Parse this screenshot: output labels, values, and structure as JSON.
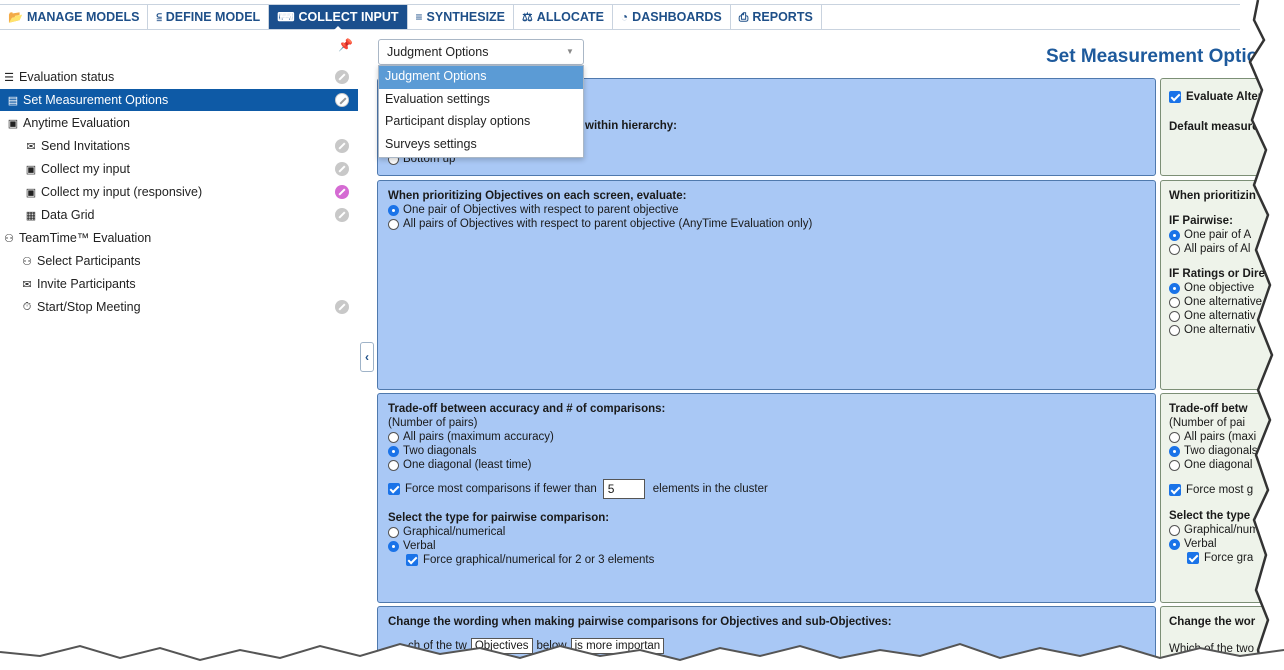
{
  "topnav": {
    "tabs": [
      {
        "label": "MANAGE MODELS",
        "icon": "folder-icon",
        "glyph": "📂"
      },
      {
        "label": "DEFINE MODEL",
        "icon": "hierarchy-icon",
        "glyph": "⫅"
      },
      {
        "label": "COLLECT INPUT",
        "icon": "keyboard-icon",
        "glyph": "⌨"
      },
      {
        "label": "SYNTHESIZE",
        "icon": "bar-chart-icon",
        "glyph": "≡"
      },
      {
        "label": "ALLOCATE",
        "icon": "scale-icon",
        "glyph": "⚖"
      },
      {
        "label": "DASHBOARDS",
        "icon": "gauge-icon",
        "glyph": "◔"
      },
      {
        "label": "REPORTS",
        "icon": "printer-icon",
        "glyph": "⎙"
      }
    ]
  },
  "sidebar": {
    "pin_glyph": "📌",
    "items": [
      {
        "label": "Evaluation status",
        "glyph": "☰"
      },
      {
        "label": "Set Measurement Options",
        "glyph": "▤"
      },
      {
        "label": "Anytime Evaluation",
        "glyph": "▣"
      },
      {
        "label": "Send Invitations",
        "glyph": "✉"
      },
      {
        "label": "Collect my input",
        "glyph": "▣"
      },
      {
        "label": "Collect my input (responsive)",
        "glyph": "▣"
      },
      {
        "label": "Data Grid",
        "glyph": "▦"
      },
      {
        "label": "TeamTime™ Evaluation",
        "glyph": "⚇"
      },
      {
        "label": "Select Participants",
        "glyph": "⚇"
      },
      {
        "label": "Invite Participants",
        "glyph": "✉"
      },
      {
        "label": "Start/Stop Meeting",
        "glyph": "⏱"
      }
    ],
    "collapse_glyph": "‹"
  },
  "main": {
    "page_title": "Set Measurement Optio",
    "select": {
      "value": "Judgment Options",
      "options": [
        "Judgment Options",
        "Evaluation settings",
        "Participant display options",
        "Surveys settings"
      ]
    },
    "panel1": {
      "partial_text": "within hierarchy:",
      "partial_option": "Bottom up"
    },
    "panel2": {
      "heading": "When prioritizing Objectives on each screen, evaluate:",
      "options": [
        "One pair of Objectives with respect to parent objective",
        "All pairs of Objectives with respect to parent objective (AnyTime Evaluation only)"
      ]
    },
    "panel3": {
      "heading": "Trade-off between accuracy and # of comparisons:",
      "subheading": "(Number of pairs)",
      "options": [
        "All pairs (maximum accuracy)",
        "Two diagonals",
        "One diagonal (least time)"
      ],
      "force_prefix": "Force most comparisons if fewer than",
      "force_value": "5",
      "force_suffix": "elements in the cluster",
      "type_heading": "Select the type for pairwise comparison:",
      "type_options": [
        "Graphical/numerical",
        "Verbal"
      ],
      "type_force": "Force graphical/numerical for 2 or 3 elements"
    },
    "panel4": {
      "heading": "Change the wording when making pairwise comparisons for Objectives and sub-Objectives:",
      "line_a": "ch of the tw",
      "input_a": "Objectives",
      "line_b": "below",
      "input_b": "is more importan"
    },
    "right": {
      "p1_check": "Evaluate Altern",
      "p1_label": "Default measure",
      "p2_heading": "When prioritizin",
      "p2_sub1": "IF Pairwise:",
      "p2_pw": [
        "One pair of A",
        "All pairs of Al"
      ],
      "p2_sub2": "IF Ratings or Dire",
      "p2_rt": [
        "One objective",
        "One alternative",
        "One alternativ",
        "One alternativ"
      ],
      "p3_heading": "Trade-off betw",
      "p3_sub": "(Number of pai",
      "p3_opts": [
        "All pairs (maxi",
        "Two diagonals",
        "One diagonal"
      ],
      "p3_force": "Force most g",
      "p3_type": "Select the type",
      "p3_type_opts": [
        "Graphical/num",
        "Verbal"
      ],
      "p3_type_force": "Force gra",
      "p4_heading": "Change the wor",
      "p4_line": "Which of the two"
    }
  }
}
